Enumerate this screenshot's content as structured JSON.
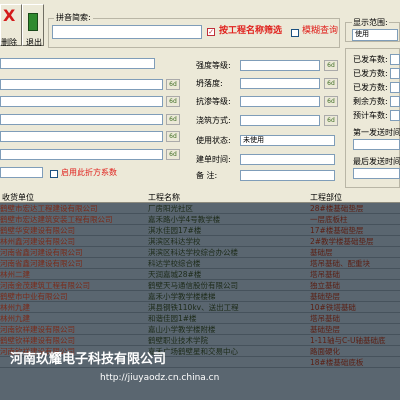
{
  "toolbar": {
    "delete_label": "删除",
    "exit_label": "退出"
  },
  "search": {
    "group_label": "按工程名称筛选查询",
    "search_label": "拼音简索:",
    "by_project_label": "按工程名称筛选",
    "fuzzy_label": "模糊查询"
  },
  "display_range": {
    "label": "显示范围:",
    "value": "使用"
  },
  "form": {
    "strength_label": "强度等级:",
    "slump_label": "坍落度:",
    "impermeability_label": "抗渗等级:",
    "pour_method_label": "浇筑方式:",
    "use_status_label": "使用状态:",
    "build_time_label": "建单时间:",
    "remark_label": "备    注:",
    "use_status_value": "未使用",
    "use_discount_label": "启用此折方系数",
    "browse_glyph": "6d"
  },
  "stats": {
    "shipped_count_label": "已发车数:",
    "shipped_qty_label": "已发方数:",
    "shipped_qty2_label": "已发方数:",
    "remaining_label": "剩余方数:",
    "estimated_label": "预计车数:",
    "first_send_label": "第一发送时间",
    "last_send_label": "最后发送时间"
  },
  "grid": {
    "headers": [
      "收货单位",
      "工程名称",
      "工程部位"
    ],
    "rows": [
      [
        "鹤壁市宏达工程建设有限公司",
        "厂房阳光社区",
        "28#楼基础垫层"
      ],
      [
        "鹤壁市宏达建筑安装工程有限公司",
        "嘉禾路小学4号教学楼",
        "一层底板柱"
      ],
      [
        "鹤壁华安建设有限公司",
        "淇水佳园17#楼",
        "17#楼基础垫层"
      ],
      [
        "林州鑫河建设有限公司",
        "淇滨区科达学校",
        "2#教学楼基础垫层"
      ],
      [
        "河南省鑫河建设有限公司",
        "淇滨区科达学校综合办公楼",
        "基础层"
      ],
      [
        "河南省鑫河建设有限公司",
        "科达学校综合楼",
        "塔吊基础、配重块"
      ],
      [
        "林州二建",
        "天润嘉城28#楼",
        "塔吊基础"
      ],
      [
        "河南金茂建筑工程有限公司",
        "鹤壁天马通信股份有限公司",
        "独立基础"
      ],
      [
        "鹤壁市中业有限公司",
        "嘉禾小学教学楼楼梯",
        "基础垫层"
      ],
      [
        "林州九建",
        "淇县钢铁110kv、送出工程",
        "10#铁塔基础"
      ],
      [
        "林州九建",
        "和谐佳园1#楼",
        "塔吊基础"
      ],
      [
        "河南钦祥建设有限公司",
        "嘉山小学教学楼附楼",
        "基础垫层"
      ],
      [
        "鹤壁钦祥建设有限公司",
        "鹤壁职业技术学院",
        "1-11轴与C-U轴基础底"
      ],
      [
        "河南钦祥建设有限公司",
        "嘉禾广场鹤壁星和交易中心",
        "路面硬化"
      ],
      [
        "",
        "",
        "18#楼基础底板"
      ]
    ]
  },
  "watermark": {
    "company": "河南玖耀电子科技有限公司",
    "url": "http://jiuyaodz.cn.china.cn"
  },
  "colors": {
    "accent_red": "#e0201c",
    "grid_bg": "#5a6670",
    "form_bg": "#ece9d8"
  }
}
